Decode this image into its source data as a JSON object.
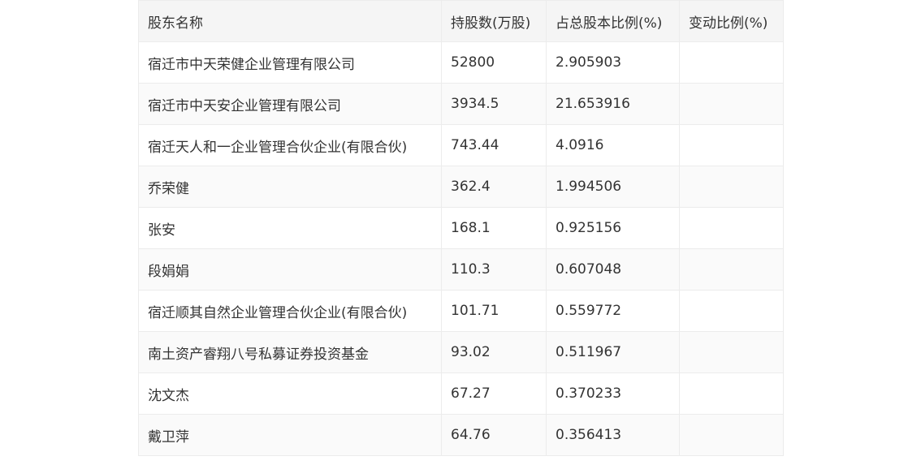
{
  "headers": [
    "股东名称",
    "持股数(万股)",
    "占总股本比例(%)",
    "变动比例(%)"
  ],
  "rows": [
    {
      "name": "宿迁市中天荣健企业管理有限公司",
      "shares": "52800",
      "ratio": "2.905903",
      "change": ""
    },
    {
      "name": "宿迁市中天安企业管理有限公司",
      "shares": "3934.5",
      "ratio": "21.653916",
      "change": ""
    },
    {
      "name": "宿迁天人和一企业管理合伙企业(有限合伙)",
      "shares": "743.44",
      "ratio": "4.0916",
      "change": ""
    },
    {
      "name": "乔荣健",
      "shares": "362.4",
      "ratio": "1.994506",
      "change": ""
    },
    {
      "name": "张安",
      "shares": "168.1",
      "ratio": "0.925156",
      "change": ""
    },
    {
      "name": "段娟娟",
      "shares": "110.3",
      "ratio": "0.607048",
      "change": ""
    },
    {
      "name": "宿迁顺其自然企业管理合伙企业(有限合伙)",
      "shares": "101.71",
      "ratio": "0.559772",
      "change": ""
    },
    {
      "name": "南土资产睿翔八号私募证券投资基金",
      "shares": "93.02",
      "ratio": "0.511967",
      "change": ""
    },
    {
      "name": "沈文杰",
      "shares": "67.27",
      "ratio": "0.370233",
      "change": ""
    },
    {
      "name": "戴卫萍",
      "shares": "64.76",
      "ratio": "0.356413",
      "change": ""
    }
  ]
}
